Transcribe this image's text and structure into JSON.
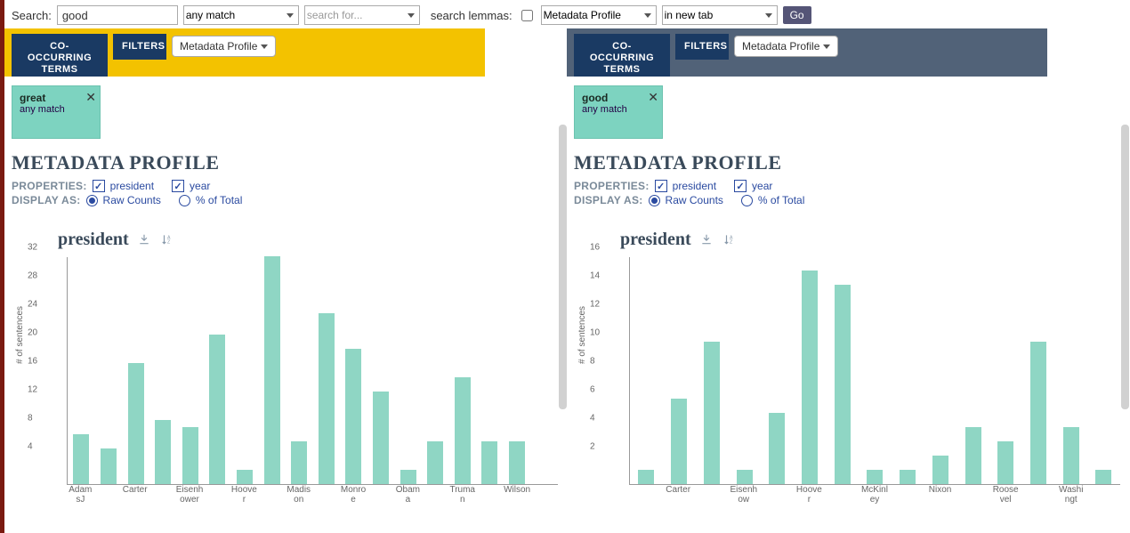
{
  "searchbar": {
    "label": "Search:",
    "query": "good",
    "match_mode": "any match",
    "search_for_placeholder": "search for...",
    "lemmas_label": "search lemmas:",
    "lemmas_checked": false,
    "profile": "Metadata Profile",
    "target": "in new tab",
    "go": "Go"
  },
  "tabs": {
    "cooccurring": "CO-OCCURRING TERMS",
    "filters": "FILTERS",
    "mini_select": "Metadata Profile"
  },
  "section_title": "METADATA PROFILE",
  "properties_label": "PROPERTIES:",
  "display_label": "DISPLAY AS:",
  "prop_president": "president",
  "prop_year": "year",
  "disp_raw": "Raw Counts",
  "disp_pct": "% of Total",
  "left": {
    "chip_term": "great",
    "chip_sub": "any match"
  },
  "right": {
    "chip_term": "good",
    "chip_sub": "any match"
  },
  "chart_data": [
    {
      "pane": "left",
      "title": "president",
      "type": "bar",
      "ylabel": "# of sentences",
      "ylim": [
        0,
        32
      ],
      "yticks": [
        4,
        8,
        12,
        16,
        20,
        24,
        28,
        32
      ],
      "categories": [
        "AdamsJ",
        "",
        "Carter",
        "",
        "Eisenhower",
        "",
        "Hoover",
        "",
        "Madison",
        "",
        "Monroe",
        "",
        "Obama",
        "",
        "Truman",
        "",
        "Wilson",
        ""
      ],
      "values": [
        7,
        5,
        17,
        9,
        8,
        21,
        2,
        32,
        6,
        24,
        19,
        13,
        2,
        6,
        15,
        6,
        6,
        0
      ]
    },
    {
      "pane": "right",
      "title": "president",
      "type": "bar",
      "ylabel": "# of sentences",
      "ylim": [
        0,
        16
      ],
      "yticks": [
        2,
        4,
        6,
        8,
        10,
        12,
        14,
        16
      ],
      "categories": [
        "",
        "Carter",
        "",
        "Eisenhow",
        "",
        "Hoover",
        "",
        "McKinley",
        "",
        "Nixon",
        "",
        "Roosevel",
        "",
        "Washingt",
        ""
      ],
      "values": [
        1,
        6,
        10,
        1,
        5,
        15,
        14,
        1,
        1,
        2,
        4,
        3,
        10,
        4,
        1
      ]
    }
  ]
}
